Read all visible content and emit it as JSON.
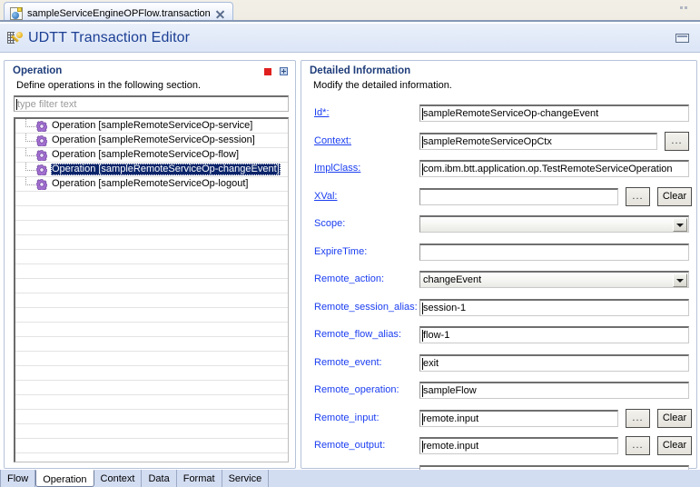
{
  "window": {
    "editor_tab_label": "sampleServiceEngineOPFlow.transaction",
    "tab_file_icon": "transaction-file-icon",
    "tab_close_icon": "close-icon",
    "restore_icon": "restore-icon",
    "form_title": "UDTT Transaction Editor",
    "form_title_icon": "udtt-key-icon"
  },
  "operation_section": {
    "title": "Operation",
    "subtitle": "Define operations in the following section.",
    "tools": [
      {
        "name": "stop-icon",
        "color": "#e01f1f"
      },
      {
        "name": "maximize-icon",
        "color": "#2f4f86"
      }
    ],
    "filter": {
      "placeholder": "type filter text",
      "value": ""
    },
    "tree_items": [
      {
        "label": "Operation [sampleRemoteServiceOp-service]",
        "icon": "gear-icon",
        "selected": false
      },
      {
        "label": "Operation [sampleRemoteServiceOp-session]",
        "icon": "gear-icon",
        "selected": false
      },
      {
        "label": "Operation [sampleRemoteServiceOp-flow]",
        "icon": "gear-icon",
        "selected": false
      },
      {
        "label": "Operation [sampleRemoteServiceOp-changeEvent]",
        "icon": "gear-icon",
        "selected": true
      },
      {
        "label": "Operation [sampleRemoteServiceOp-logout]",
        "icon": "gear-icon",
        "selected": false
      }
    ],
    "empty_row_count": 18
  },
  "detail_section": {
    "title": "Detailed Information",
    "subtitle": "Modify the detailed information.",
    "fields": [
      {
        "label": "Id*:",
        "link": true,
        "value": "sampleRemoteServiceOp-changeEvent",
        "type": "text",
        "caret": true,
        "buttons": []
      },
      {
        "label": "Context:",
        "link": true,
        "value": "sampleRemoteServiceOpCtx",
        "type": "text",
        "caret": true,
        "buttons": [
          "..."
        ]
      },
      {
        "label": "ImplClass:",
        "link": true,
        "value": "com.ibm.btt.application.op.TestRemoteServiceOperation",
        "type": "text",
        "caret": true,
        "buttons": []
      },
      {
        "label": "XVal:",
        "link": true,
        "value": "",
        "type": "text",
        "caret": false,
        "buttons": [
          "...",
          "Clear"
        ]
      },
      {
        "label": "Scope:",
        "link": false,
        "value": "",
        "type": "combo",
        "caret": false,
        "buttons": []
      },
      {
        "label": "ExpireTime:",
        "link": false,
        "value": "",
        "type": "text",
        "caret": false,
        "buttons": []
      },
      {
        "label": "Remote_action:",
        "link": false,
        "value": "changeEvent",
        "type": "combo",
        "caret": false,
        "buttons": []
      },
      {
        "label": "Remote_session_alias:",
        "link": false,
        "value": "session-1",
        "type": "text",
        "caret": true,
        "buttons": []
      },
      {
        "label": "Remote_flow_alias:",
        "link": false,
        "value": "flow-1",
        "type": "text",
        "caret": true,
        "buttons": []
      },
      {
        "label": "Remote_event:",
        "link": false,
        "value": "exit",
        "type": "text",
        "caret": true,
        "buttons": []
      },
      {
        "label": "Remote_operation:",
        "link": false,
        "value": "sampleFlow",
        "type": "text",
        "caret": true,
        "buttons": []
      },
      {
        "label": "Remote_input:",
        "link": false,
        "value": "remote.input",
        "type": "text",
        "caret": true,
        "buttons": [
          "...",
          "Clear"
        ]
      },
      {
        "label": "Remote_output:",
        "link": false,
        "value": "remote.input",
        "type": "text",
        "caret": true,
        "buttons": [
          "...",
          "Clear"
        ]
      }
    ]
  },
  "bottom_tabs": [
    {
      "label": "Flow",
      "active": false
    },
    {
      "label": "Operation",
      "active": true
    },
    {
      "label": "Context",
      "active": false
    },
    {
      "label": "Data",
      "active": false
    },
    {
      "label": "Format",
      "active": false
    },
    {
      "label": "Service",
      "active": false
    }
  ],
  "colors": {
    "accent_blue": "#1a3df0",
    "section_title": "#1f3d7a",
    "selection": "#0a246a",
    "tab_bar": "#d3ddf2",
    "stop_red": "#e01f1f"
  }
}
